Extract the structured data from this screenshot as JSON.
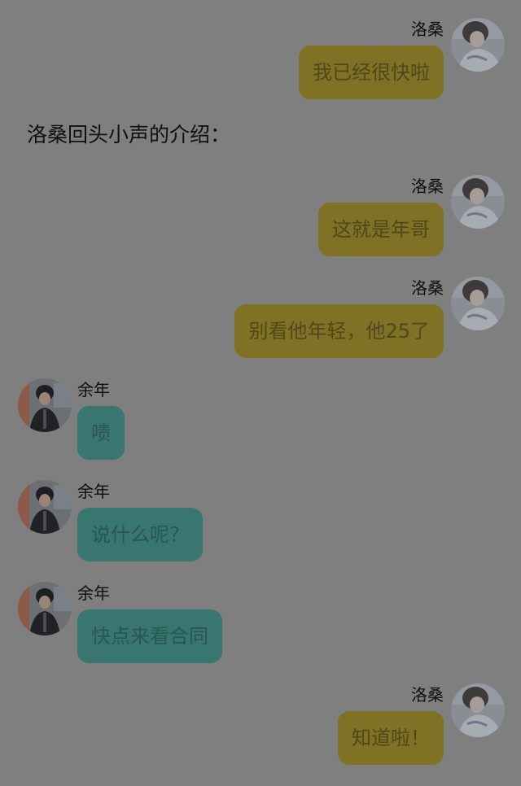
{
  "chat": {
    "messages": [
      {
        "side": "right",
        "sender": "洛桑",
        "text": "我已经很快啦"
      },
      {
        "side": "right",
        "sender": "洛桑",
        "text": "这就是年哥"
      },
      {
        "side": "right",
        "sender": "洛桑",
        "text": "别看他年轻，他25了"
      },
      {
        "side": "left",
        "sender": "余年",
        "text": "啧"
      },
      {
        "side": "left",
        "sender": "余年",
        "text": "说什么呢？"
      },
      {
        "side": "left",
        "sender": "余年",
        "text": "快点来看合同"
      },
      {
        "side": "right",
        "sender": "洛桑",
        "text": "知道啦！"
      }
    ],
    "narration": "洛桑回头小声的介绍："
  },
  "colors": {
    "background": "#7f7f7f",
    "right_bubble": "#807225",
    "left_bubble": "#38766f"
  },
  "icons": {
    "right_avatar": "avatar-photo-luosang",
    "left_avatar": "avatar-photo-yunian"
  }
}
